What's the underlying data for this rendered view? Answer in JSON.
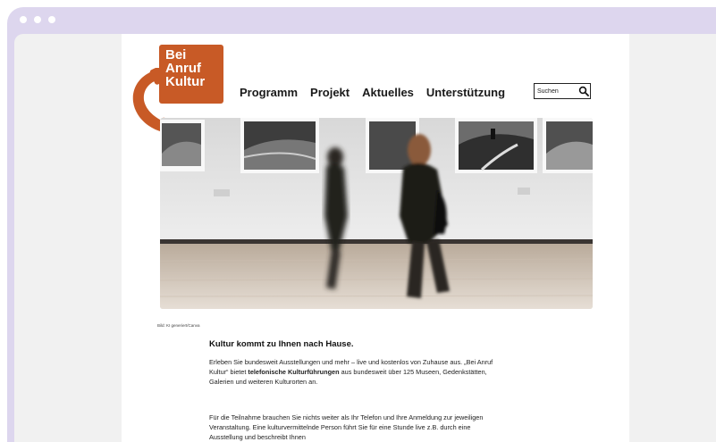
{
  "logo": {
    "line1": "Bei",
    "line2": "Anruf",
    "line3": "Kultur",
    "color": "#c85a26"
  },
  "nav": {
    "items": [
      "Programm",
      "Projekt",
      "Aktuelles",
      "Unterstützung"
    ]
  },
  "search": {
    "placeholder": "Suchen",
    "icon": "search-icon"
  },
  "hero": {
    "caption": "Bild: KI generiert/Canva"
  },
  "content": {
    "headline": "Kultur kommt zu Ihnen nach Hause.",
    "p1_a": "Erleben Sie bundesweit Ausstellungen und mehr – live und kostenlos von Zuhause aus. „Bei Anruf Kultur“ bietet ",
    "p1_bold": "telefonische Kulturführungen",
    "p1_b": " aus bundesweit über 125 Museen, Gedenkstätten, Galerien und weiteren Kulturorten an.",
    "p2": "Für die Teilnahme brauchen Sie nichts weiter als Ihr Telefon und Ihre Anmeldung zur jeweiligen Veranstaltung. Eine kulturvermittelnde Person führt Sie für eine Stunde live z.B. durch eine Ausstellung und beschreibt Ihnen"
  },
  "colors": {
    "frame": "#ddd6ee",
    "viewport": "#f1f1f1",
    "accent": "#c85a26"
  }
}
